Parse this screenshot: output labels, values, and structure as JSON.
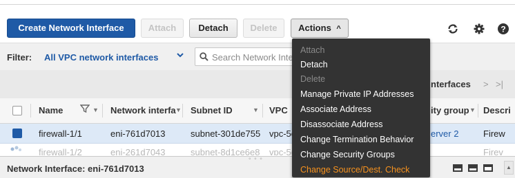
{
  "toolbar": {
    "create_label": "Create Network Interface",
    "attach_label": "Attach",
    "detach_label": "Detach",
    "delete_label": "Delete",
    "actions_label": "Actions",
    "actions_caret": "^",
    "icons": [
      "refresh-icon",
      "settings-icon",
      "help-icon"
    ]
  },
  "filter": {
    "label": "Filter:",
    "value": "All VPC network interfaces",
    "caret": "v",
    "search_placeholder": "Search Network Inte"
  },
  "pager": {
    "text": "nterfaces",
    "next": ">",
    "last": ">|"
  },
  "table": {
    "columns": [
      "Name",
      "Network interfa",
      "Subnet ID",
      "VPC",
      "ity group",
      "Descri"
    ],
    "rows": [
      {
        "name": "firewall-1/1",
        "eni": "eni-761d7013",
        "subnet": "subnet-301de755",
        "vpc": "vpc-5e",
        "group": "erver 2",
        "desc": "Firew",
        "selected": true
      },
      {
        "name": "firewall-1/2",
        "eni": "eni-261d7043",
        "subnet": "subnet-8d1ce6e8",
        "vpc": "vpc-5e",
        "group": "",
        "desc": "Firev",
        "selected": false
      }
    ]
  },
  "detail": {
    "title": "Network Interface: eni-761d7013",
    "resize_handle": "° ° °"
  },
  "actions_menu": {
    "items": [
      {
        "label": "Attach",
        "state": "disabled"
      },
      {
        "label": "Detach",
        "state": "enabled"
      },
      {
        "label": "Delete",
        "state": "disabled"
      },
      {
        "label": "Manage Private IP Addresses",
        "state": "enabled"
      },
      {
        "label": "Associate Address",
        "state": "enabled"
      },
      {
        "label": "Disassociate Address",
        "state": "enabled"
      },
      {
        "label": "Change Termination Behavior",
        "state": "enabled"
      },
      {
        "label": "Change Security Groups",
        "state": "enabled"
      },
      {
        "label": "Change Source/Dest. Check",
        "state": "highlighted"
      }
    ]
  },
  "colors": {
    "primary": "#1f5aa6",
    "menu_bg": "#333333",
    "menu_highlight": "#f7921e",
    "row_selected": "#dde9f7"
  }
}
